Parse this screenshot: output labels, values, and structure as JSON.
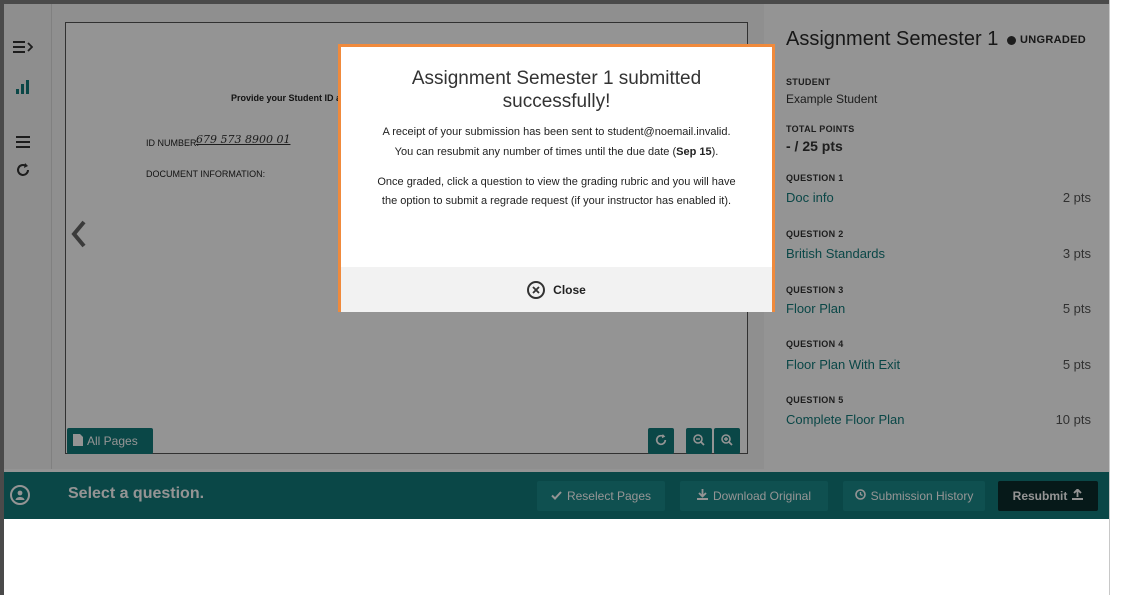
{
  "rail": {
    "icons": [
      "menu-expand-icon",
      "bar-chart-icon",
      "list-icon",
      "rotate-icon"
    ]
  },
  "viewer": {
    "doc": {
      "heading": "Provide your Student ID a",
      "id_label": "ID NUMBER:",
      "id_value": "679 573 8900 01",
      "doc_info_label": "DOCUMENT INFORMATION:"
    },
    "all_pages_label": "All Pages"
  },
  "panel": {
    "title": "Assignment Semester 1",
    "status": "UNGRADED",
    "student_label": "STUDENT",
    "student_name": "Example Student",
    "total_label": "TOTAL POINTS",
    "total_value": "- / 25 pts",
    "questions": [
      {
        "label": "QUESTION 1",
        "title": "Doc info",
        "points": "2 pts"
      },
      {
        "label": "QUESTION 2",
        "title": "British Standards",
        "points": "3 pts"
      },
      {
        "label": "QUESTION 3",
        "title": "Floor Plan",
        "points": "5 pts"
      },
      {
        "label": "QUESTION 4",
        "title": "Floor Plan With Exit",
        "points": "5 pts"
      },
      {
        "label": "QUESTION 5",
        "title": "Complete Floor Plan",
        "points": "10 pts"
      }
    ]
  },
  "bottom_bar": {
    "prompt": "Select a question.",
    "reselect_label": "Reselect Pages",
    "download_label": "Download Original",
    "history_label": "Submission History",
    "resubmit_label": "Resubmit"
  },
  "modal": {
    "title": "Assignment Semester 1 submitted successfully!",
    "receipt_text": "A receipt of your submission has been sent to student@noemail.invalid.",
    "resubmit_text_pre": "You can resubmit any number of times until the due date (",
    "due_date": "Sep 15",
    "resubmit_text_post": ").",
    "graded_text": "Once graded, click a question to view the grading rubric and you will have the option to submit a regrade request (if your instructor has enabled it).",
    "close_label": "Close"
  },
  "colors": {
    "teal": "#127a7a",
    "modal_border": "#f08a3c",
    "resubmit_bg": "#0b2b2b"
  }
}
